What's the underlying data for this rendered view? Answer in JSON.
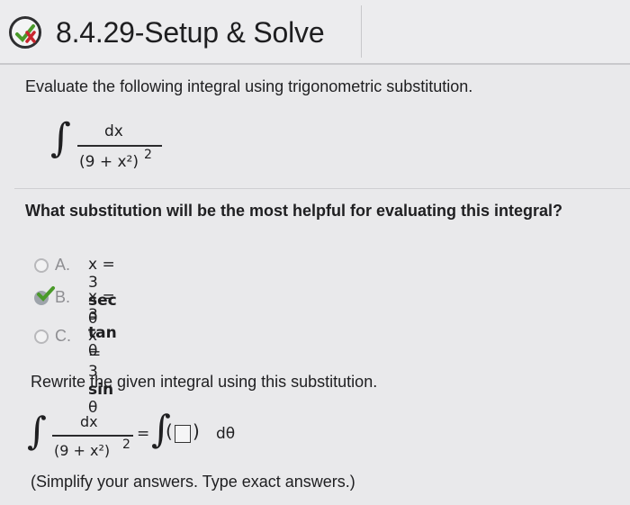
{
  "header": {
    "title": "8.4.29-Setup & Solve",
    "status_icon": "partially-correct-icon"
  },
  "prompt": "Evaluate the following integral using trigonometric substitution.",
  "integral": {
    "sign": "∫",
    "numerator": "dx",
    "denominator": "(9 + x²)",
    "exponent": "2"
  },
  "question": "What substitution will be the most helpful for evaluating this integral?",
  "options": [
    {
      "letter": "A.",
      "expr": "x = 3 sec θ",
      "selected": false
    },
    {
      "letter": "B.",
      "expr": "x = 3 tan θ",
      "selected": true
    },
    {
      "letter": "C.",
      "expr": "x = 3 sin θ",
      "selected": false
    }
  ],
  "rewrite_prompt": "Rewrite the given integral using this substitution.",
  "rewrite": {
    "sign": "∫",
    "numerator": "dx",
    "denominator": "(9 + x²)",
    "exponent": "2",
    "equals": "=",
    "rhs_sign": "∫",
    "open_paren": "(",
    "close_paren": ")",
    "differential": "dθ"
  },
  "hint": "(Simplify your answers. Type exact answers.)",
  "colors": {
    "check_green": "#4a9a2a",
    "x_red": "#c8262e"
  }
}
